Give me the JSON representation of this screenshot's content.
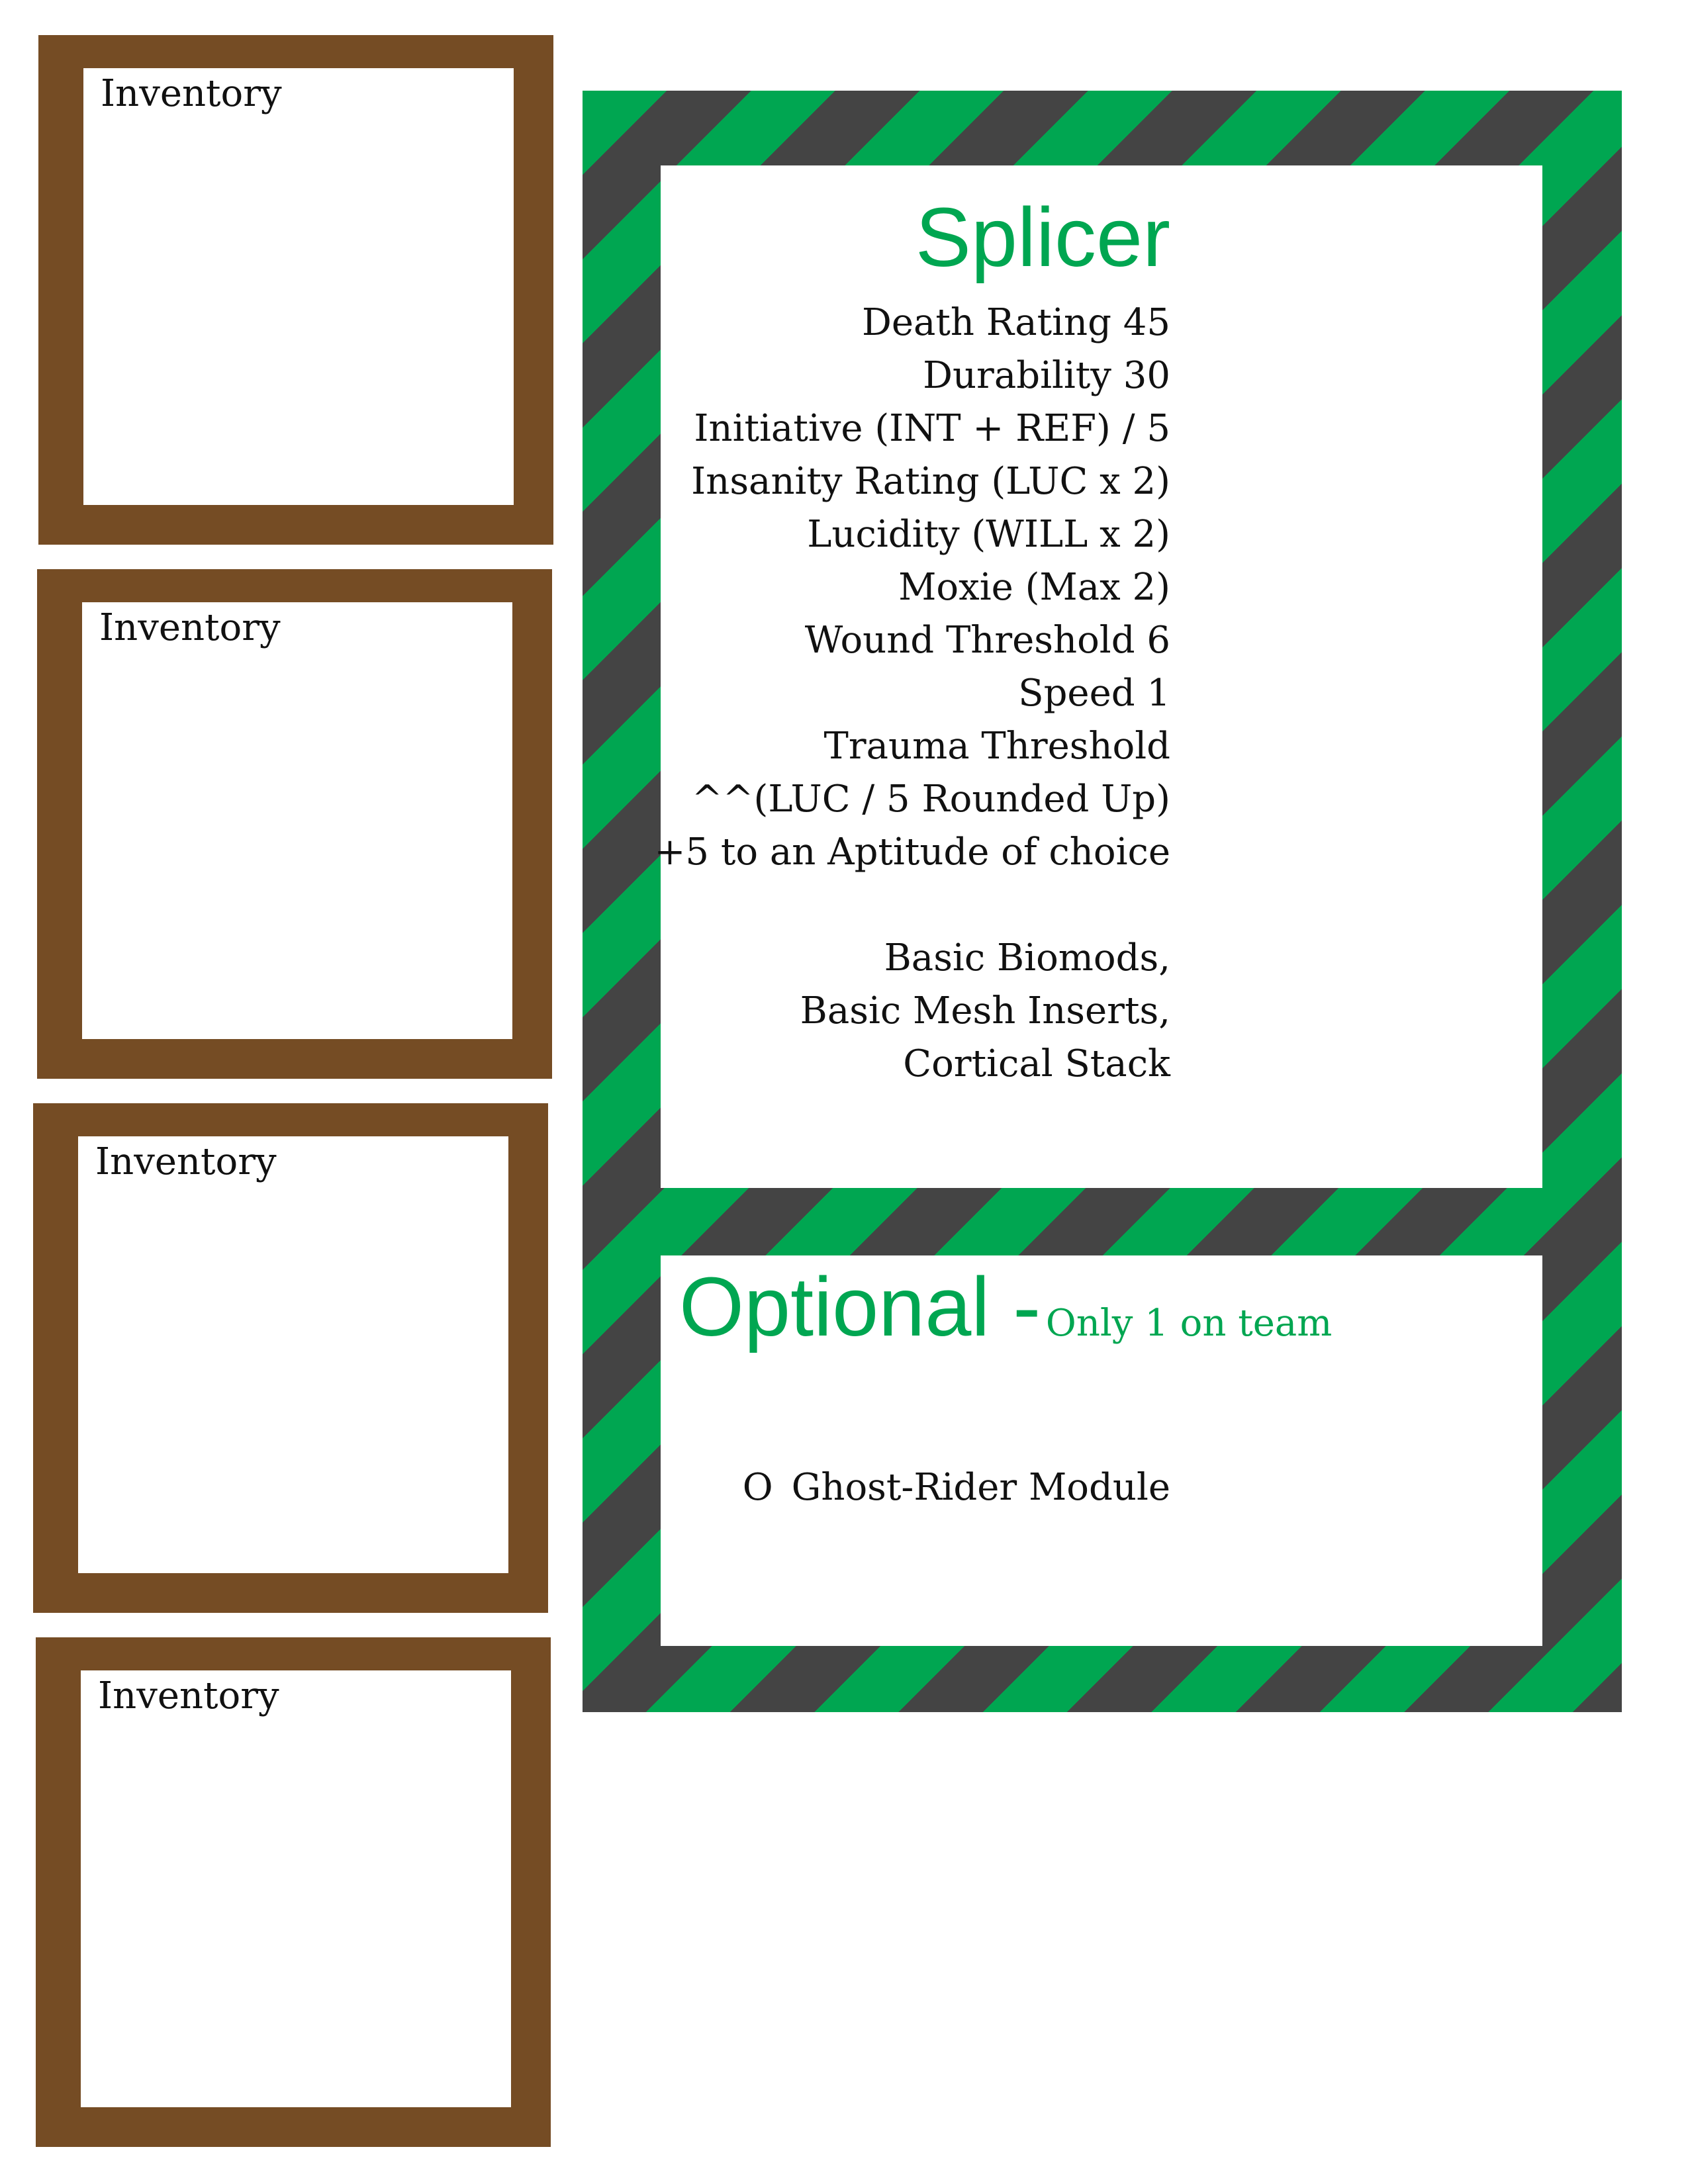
{
  "inventory_boxes": [
    {
      "label": "Inventory"
    },
    {
      "label": "Inventory"
    },
    {
      "label": "Inventory"
    },
    {
      "label": "Inventory"
    }
  ],
  "card": {
    "title": "Splicer",
    "stats": [
      "Death Rating 45",
      "Durability 30",
      "Initiative (INT + REF) / 5",
      "Insanity Rating (LUC x 2)",
      "Lucidity (WILL x 2)",
      "Moxie (Max 2)",
      "Wound Threshold 6",
      "Speed 1",
      "Trauma Threshold",
      "^^(LUC / 5 Rounded Up)",
      "+5 to an Aptitude of choice",
      "",
      "Basic Biomods,",
      "Basic Mesh Inserts,",
      "Cortical Stack"
    ],
    "optional": {
      "title": "Optional -",
      "note": "Only 1 on team",
      "option_marker": "O",
      "option_label": "Ghost-Rider Module"
    }
  },
  "colors": {
    "inventory_frame": "#754c24",
    "stripe_green": "#00a651",
    "stripe_gray": "#444444",
    "accent_text": "#00a651"
  }
}
